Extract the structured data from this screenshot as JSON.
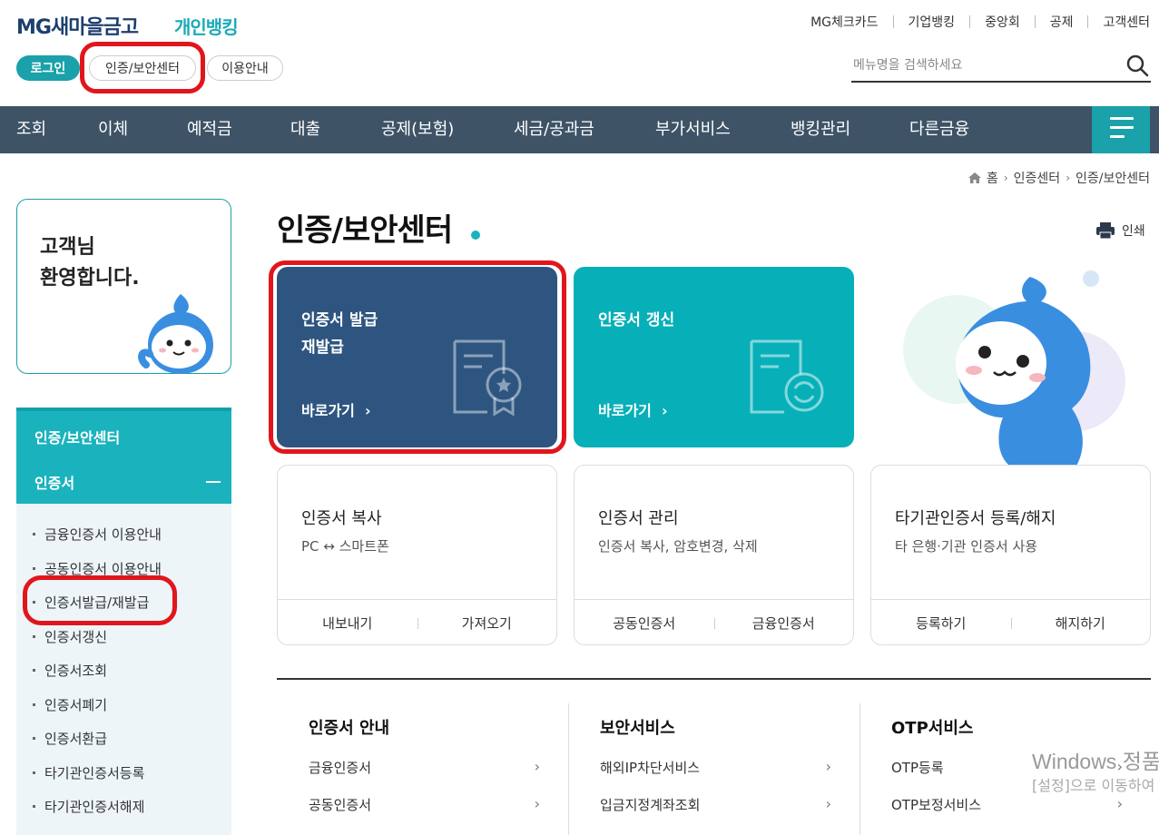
{
  "header": {
    "logo_main": "MG새마을금고",
    "logo_sub": "개인뱅킹",
    "top_links": [
      "MG체크카드",
      "기업뱅킹",
      "중앙회",
      "공제",
      "고객센터"
    ],
    "login_label": "로그인",
    "cert_center_label": "인증/보안센터",
    "guide_label": "이용안내",
    "search_placeholder": "메뉴명을 검색하세요"
  },
  "nav": {
    "items": [
      "조회",
      "이체",
      "예적금",
      "대출",
      "공제(보험)",
      "세금/공과금",
      "부가서비스",
      "뱅킹관리",
      "다른금융"
    ]
  },
  "breadcrumb": [
    "홈",
    "인증센터",
    "인증/보안센터"
  ],
  "welcome": {
    "line1": "고객님",
    "line2": "환영합니다."
  },
  "sidebar": {
    "section": "인증/보안센터",
    "group": "인증서",
    "items": [
      "금융인증서 이용안내",
      "공동인증서 이용안내",
      "인증서발급/재발급",
      "인증서갱신",
      "인증서조회",
      "인증서폐기",
      "인증서환급",
      "타기관인증서등록",
      "타기관인증서해제"
    ]
  },
  "main": {
    "title": "인증/보안센터",
    "print_label": "인쇄",
    "card_issue": {
      "line1": "인증서 발급",
      "line2": "재발급",
      "go": "바로가기"
    },
    "card_renew": {
      "line1": "인증서 갱신",
      "go": "바로가기"
    },
    "card_copy": {
      "title": "인증서 복사",
      "desc": "PC ↔ 스마트폰",
      "btn1": "내보내기",
      "btn2": "가져오기"
    },
    "card_manage": {
      "title": "인증서 관리",
      "desc": "인증서 복사, 암호변경, 삭제",
      "btn1": "공동인증서",
      "btn2": "금융인증서"
    },
    "card_other": {
      "title": "타기관인증서 등록/해지",
      "desc": "타 은행·기관 인증서 사용",
      "btn1": "등록하기",
      "btn2": "해지하기"
    }
  },
  "bottom": {
    "cols": [
      {
        "head": "인증서 안내",
        "rows": [
          "금융인증서",
          "공동인증서"
        ]
      },
      {
        "head": "보안서비스",
        "rows": [
          "해외IP차단서비스",
          "입금지정계좌조회"
        ]
      },
      {
        "head": "OTP서비스",
        "rows": [
          "OTP등록",
          "OTP보정서비스"
        ]
      }
    ]
  },
  "watermark": {
    "line1": "Windows 정품 인증",
    "line2": "[설정]으로 이동하여 Windows를 정품 인증합니다."
  },
  "colors": {
    "teal": "#1aa1a9",
    "navy": "#2d5580",
    "nav_bg": "#3e5366",
    "highlight": "#e1161c"
  }
}
